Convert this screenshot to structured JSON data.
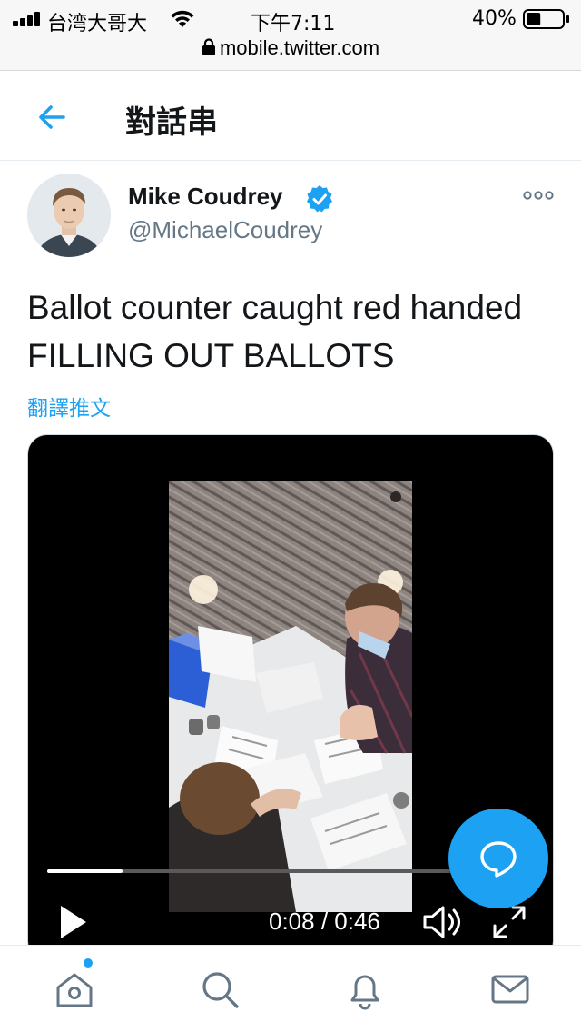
{
  "status_bar": {
    "carrier": "台湾大哥大",
    "time": "下午7:11",
    "battery_percent": "40%",
    "battery_level": 0.4
  },
  "browser": {
    "url": "mobile.twitter.com"
  },
  "header": {
    "title": "對話串"
  },
  "tweet": {
    "author_name": "Mike Coudrey",
    "author_handle": "@MichaelCoudrey",
    "verified": true,
    "text": "Ballot counter caught red handed FILLING OUT BALLOTS",
    "translate_label": "翻譯推文"
  },
  "video": {
    "current_time": "0:08",
    "duration": "0:46",
    "time_display": "0:08 / 0:46",
    "progress_fraction": 0.17
  },
  "nav": {
    "items": [
      "home-icon",
      "search-icon",
      "notifications-icon",
      "messages-icon"
    ],
    "home_has_notification": true
  },
  "colors": {
    "accent": "#1da1f2",
    "text_primary": "#14171a",
    "text_secondary": "#657786"
  }
}
